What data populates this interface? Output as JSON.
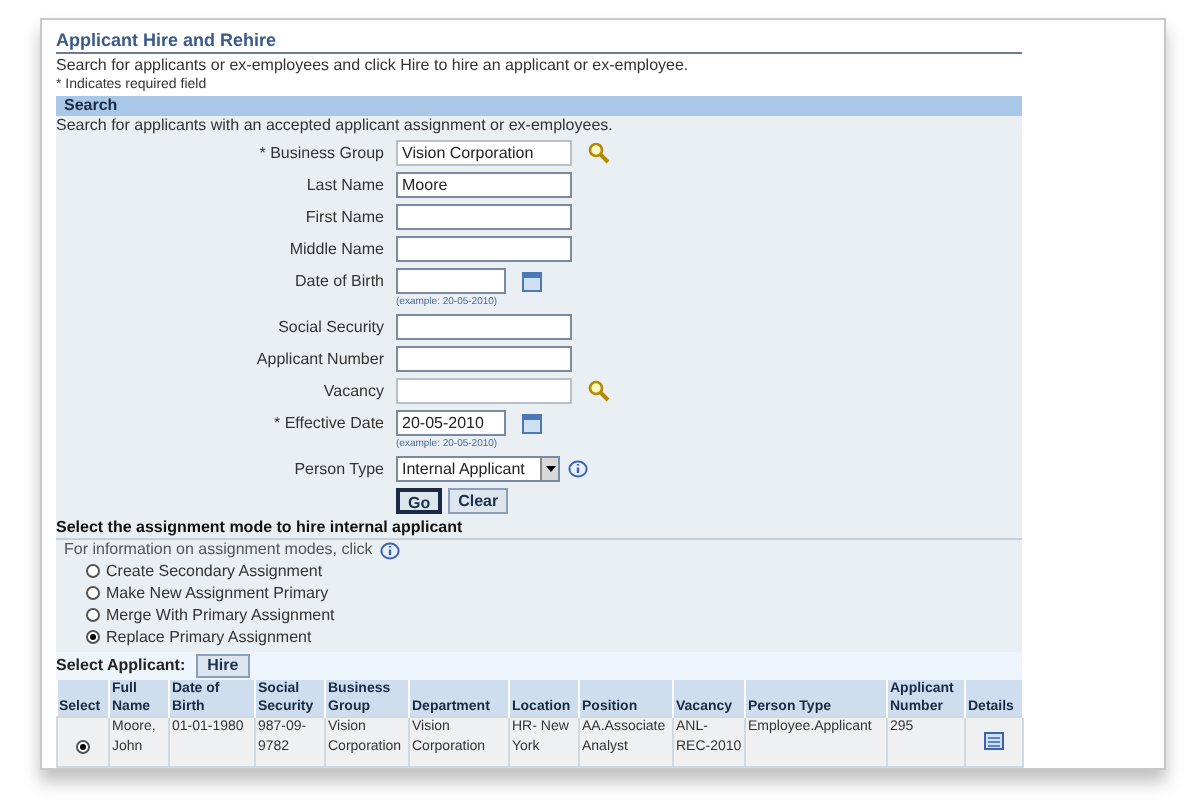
{
  "title": "Applicant Hire and Rehire",
  "intro": "Search for applicants or ex-employees and click Hire to hire an applicant or ex-employee.",
  "required_note": "* Indicates required field",
  "search": {
    "header": "Search",
    "intro": "Search for applicants with an accepted applicant assignment or ex-employees.",
    "fields": [
      {
        "label": "* Business Group",
        "kind": "lov",
        "value": "Vision Corporation"
      },
      {
        "label": "Last Name",
        "kind": "text",
        "value": "Moore"
      },
      {
        "label": "First Name",
        "kind": "text"
      },
      {
        "label": "Middle Name",
        "kind": "text"
      },
      {
        "label": "Date of Birth",
        "kind": "date",
        "hint": "(example: 20-05-2010)"
      },
      {
        "label": "Social Security",
        "kind": "text"
      },
      {
        "label": "Applicant Number",
        "kind": "text"
      },
      {
        "label": "Vacancy",
        "kind": "lov"
      },
      {
        "label": "* Effective Date",
        "kind": "date",
        "value": "20-05-2010",
        "hint": "(example: 20-05-2010)"
      },
      {
        "label": "Person Type",
        "kind": "choice",
        "value": "Internal Applicant"
      }
    ],
    "buttons": [
      "Go",
      "Clear"
    ]
  },
  "assignment": {
    "header": "Select the assignment mode to hire internal applicant",
    "info_text": "For information on assignment modes, click",
    "options": [
      {
        "label": "Create Secondary Assignment",
        "selected": false
      },
      {
        "label": "Make New Assignment Primary",
        "selected": false
      },
      {
        "label": "Merge With Primary Assignment",
        "selected": false
      },
      {
        "label": "Replace Primary Assignment",
        "selected": true
      }
    ]
  },
  "select_applicant": {
    "label": "Select Applicant:",
    "button": "Hire"
  },
  "table": {
    "columns": [
      "Select",
      "Full Name",
      "Date of Birth",
      "Social Security",
      "Business Group",
      "Department",
      "Location",
      "Position",
      "Vacancy",
      "Person Type",
      "Applicant Number",
      "Details"
    ],
    "rows": [
      {
        "selected": true,
        "cells": [
          "",
          "Moore, John",
          "01-01-1980",
          "987-09-9782",
          "Vision Corporation",
          "Vision Corporation",
          "HR- New York",
          "AA.Associate Analyst",
          "ANL-REC-2010",
          "Employee.Applicant",
          "295"
        ]
      }
    ]
  }
}
